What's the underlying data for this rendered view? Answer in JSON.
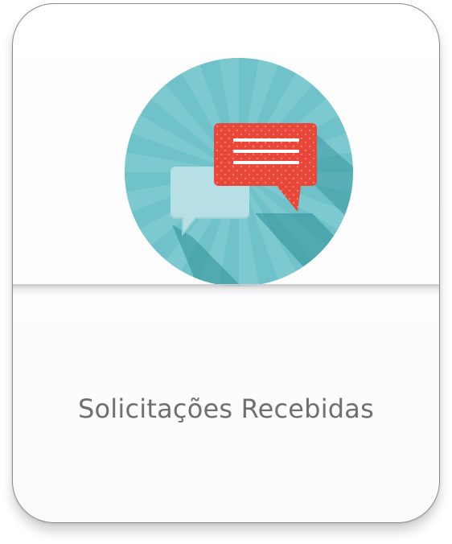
{
  "card": {
    "label": "Solicitações Recebidas",
    "icon": "chat-bubbles-icon"
  },
  "colors": {
    "circle": "#6fc2c9",
    "bubble_front": "#e8473a",
    "bubble_back": "#b7e0e6",
    "label_text": "#6f6f6f"
  }
}
